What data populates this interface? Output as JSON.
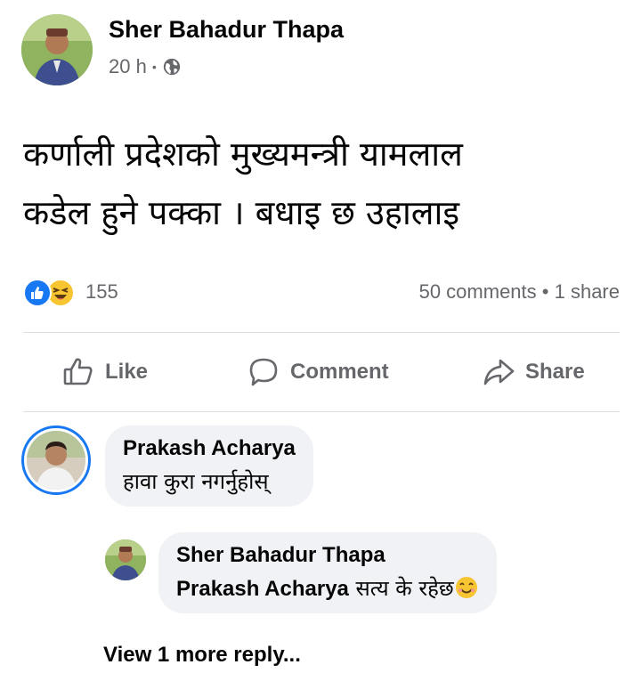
{
  "post": {
    "author": "Sher Bahadur Thapa",
    "time": "20 h",
    "separator": "•",
    "visibility_icon": "globe-icon",
    "text_line1": "कर्णाली प्रदेशको मुख्यमन्त्री यामलाल",
    "text_line2": "कडेल हुने पक्का । बधाइ छ उहालाइ"
  },
  "reactions": {
    "icons": [
      "like-reaction-icon",
      "haha-reaction-icon"
    ],
    "count": "155",
    "comments": "50 comments",
    "separator": "•",
    "shares": "1 share"
  },
  "actions": {
    "like": "Like",
    "comment": "Comment",
    "share": "Share"
  },
  "comments": [
    {
      "author": "Prakash Acharya",
      "text": "हावा कुरा नगर्नुहोस्"
    }
  ],
  "reply": {
    "author": "Sher Bahadur Thapa",
    "mention": "Prakash Acharya",
    "text": " सत्य के रहेछ",
    "emoji": "smiling-face-icon"
  },
  "view_more": "View 1 more reply...",
  "colors": {
    "accent": "#1877f2",
    "secondary_text": "#65676b",
    "bubble_bg": "#f0f2f5",
    "divider": "#dddfe2"
  }
}
